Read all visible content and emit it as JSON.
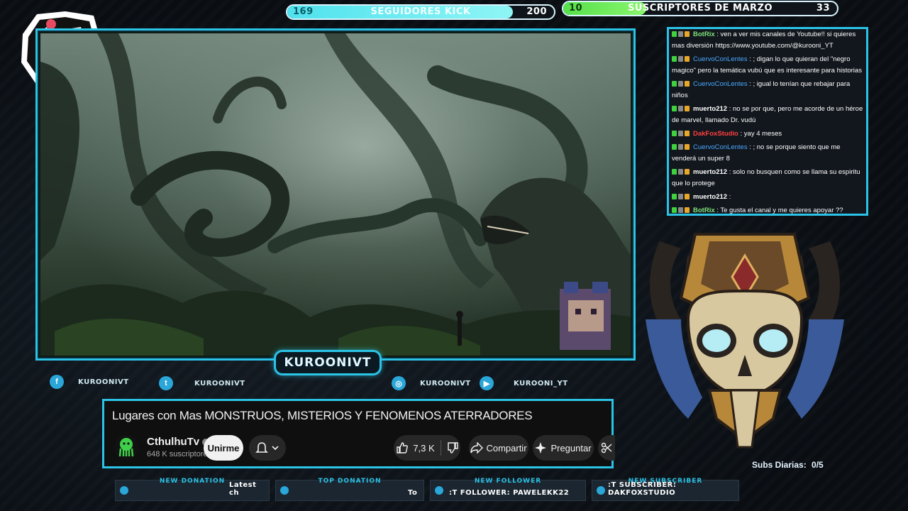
{
  "goals": {
    "kick": {
      "current": "169",
      "label": "SEGUIDORES KICK",
      "target": "200",
      "progress_percent": 84.5,
      "color": "#4fe2ee"
    },
    "subs": {
      "current": "10",
      "label": "SUSCRIPTORES DE MARZO",
      "target": "33",
      "progress_percent": 30.3,
      "color": "#56e04a"
    }
  },
  "webcam_plate": {
    "name": "KUROONIVT"
  },
  "socials": [
    {
      "icon": "facebook-icon",
      "glyph": "f",
      "label": "KUROONIVT"
    },
    {
      "icon": "twitter-icon",
      "glyph": "t",
      "label": "KUROONIVT"
    },
    {
      "icon": "instagram-icon",
      "glyph": "◎",
      "label": "KUROONIVT"
    },
    {
      "icon": "youtube-icon",
      "glyph": "▶",
      "label": "KUROONI_YT"
    }
  ],
  "youtube": {
    "title": "Lugares con Mas MONSTRUOS, MISTERIOS Y FENOMENOS ATERRADORES",
    "channel": "CthulhuTv",
    "subscribers": "648 K suscriptores",
    "join_label": "Unirme",
    "likes": "7,3 K",
    "share_label": "Compartir",
    "ask_label": "Preguntar"
  },
  "chat": [
    {
      "user": "BotRix",
      "color": "green",
      "text": ": ven a ver mis canales de Youtube!! si quieres mas diversión https://www.youtube.com/@kurooni_YT"
    },
    {
      "user": "CuervoConLentes",
      "color": "blue",
      "text": ": ; digan lo que quieran del \"negro magico\" pero la temática vubú que es interesante para historias"
    },
    {
      "user": "CuervoConLentes",
      "color": "blue",
      "text": ": ; igual lo tenían que rebajar para niños"
    },
    {
      "user": "muerto212",
      "color": "white",
      "text": ": no se por que, pero me acorde de un héroe de marvel, llamado Dr. vudú"
    },
    {
      "user": "DakFoxStudio",
      "color": "red",
      "text": ": yay 4 meses"
    },
    {
      "user": "CuervoConLentes",
      "color": "blue",
      "text": ": ; no se porque siento que me venderá un super 8"
    },
    {
      "user": "muerto212",
      "color": "white",
      "text": ": solo no busquen como se llama su espiritu que lo protege"
    },
    {
      "user": "muerto212",
      "color": "white",
      "text": ":"
    },
    {
      "user": "BotRix",
      "color": "green",
      "text": ": Te gusta el canal y me quieres apoyar ?? puedes hacerlo de"
    }
  ],
  "subs_daily": {
    "label": "Subs Diarias:",
    "value": "0/5"
  },
  "alerts": [
    {
      "header": "NEW DONATION",
      "value": "Latest ch",
      "icon": "donation-icon"
    },
    {
      "header": "TOP DONATION",
      "value": "To",
      "icon": "top-donation-icon"
    },
    {
      "header": "NEW FOLLOWER",
      "value": ":T FOLLOWER: PAWELEKK22",
      "icon": "follower-icon"
    },
    {
      "header": "NEW SUBSCRIBER",
      "value": ":T SUBSCRIBER: DAKFOXSTUDIO",
      "icon": "subscriber-icon"
    }
  ]
}
